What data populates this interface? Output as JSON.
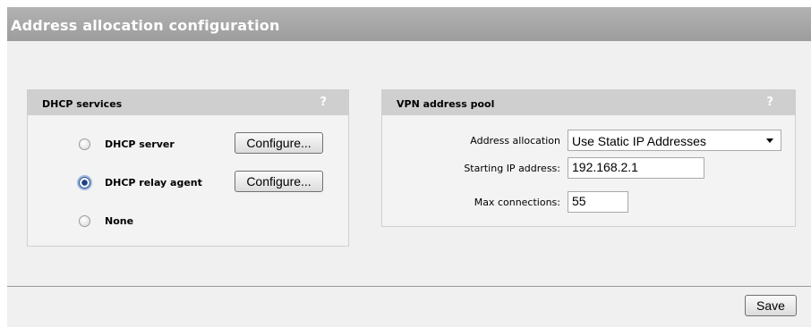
{
  "title": "Address allocation configuration",
  "dhcp_panel": {
    "title": "DHCP services",
    "help": "?",
    "options": [
      {
        "label": "DHCP server",
        "selected": false
      },
      {
        "label": "DHCP relay agent",
        "selected": true
      },
      {
        "label": "None",
        "selected": false
      }
    ],
    "configure_label": "Configure..."
  },
  "vpn_panel": {
    "title": "VPN address pool",
    "help": "?",
    "address_allocation_label": "Address allocation",
    "address_allocation_value": "Use Static IP Addresses",
    "starting_ip_label": "Starting IP address:",
    "starting_ip_value": "192.168.2.1",
    "max_connections_label": "Max connections:",
    "max_connections_value": "55"
  },
  "footer": {
    "save_label": "Save"
  },
  "colors": {
    "title_bar": "#a6a6a6",
    "panel_header": "#cfcfcf",
    "background": "#f0f0f0"
  }
}
